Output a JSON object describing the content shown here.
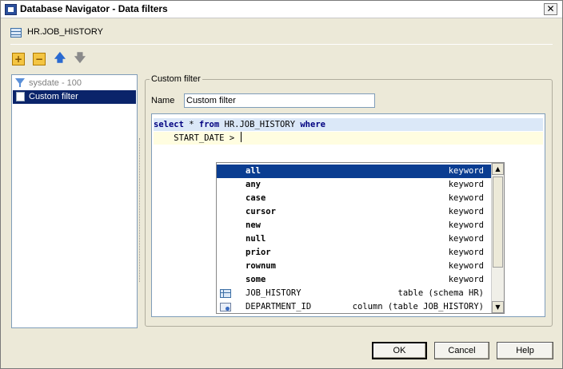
{
  "window": {
    "title": "Database Navigator - Data filters"
  },
  "header": {
    "table_name": "HR.JOB_HISTORY"
  },
  "filters": [
    {
      "label": "sysdate - 100"
    },
    {
      "label": "Custom filter"
    }
  ],
  "group": {
    "legend": "Custom filter"
  },
  "name_field": {
    "label": "Name",
    "value": "Custom filter"
  },
  "editor": {
    "line1": {
      "kw1": "select",
      "t1": " * ",
      "kw2": "from",
      "t2": " HR.JOB_HISTORY ",
      "kw3": "where"
    },
    "line2": "    START_DATE > "
  },
  "autocomplete": [
    {
      "name": "all",
      "type": "keyword",
      "icon": "none"
    },
    {
      "name": "any",
      "type": "keyword",
      "icon": "none"
    },
    {
      "name": "case",
      "type": "keyword",
      "icon": "none"
    },
    {
      "name": "cursor",
      "type": "keyword",
      "icon": "none"
    },
    {
      "name": "new",
      "type": "keyword",
      "icon": "none"
    },
    {
      "name": "null",
      "type": "keyword",
      "icon": "none"
    },
    {
      "name": "prior",
      "type": "keyword",
      "icon": "none"
    },
    {
      "name": "rownum",
      "type": "keyword",
      "icon": "none"
    },
    {
      "name": "some",
      "type": "keyword",
      "icon": "none"
    },
    {
      "name": "JOB_HISTORY",
      "type": "table (schema HR)",
      "icon": "table-icon"
    },
    {
      "name": "DEPARTMENT_ID",
      "type": "column (table JOB_HISTORY)",
      "icon": "column-icon"
    }
  ],
  "buttons": {
    "ok": "OK",
    "cancel": "Cancel",
    "help": "Help"
  },
  "colors": {
    "selection": "#0a246a",
    "popup_selection": "#0a3d91",
    "keyword": "#000080"
  }
}
